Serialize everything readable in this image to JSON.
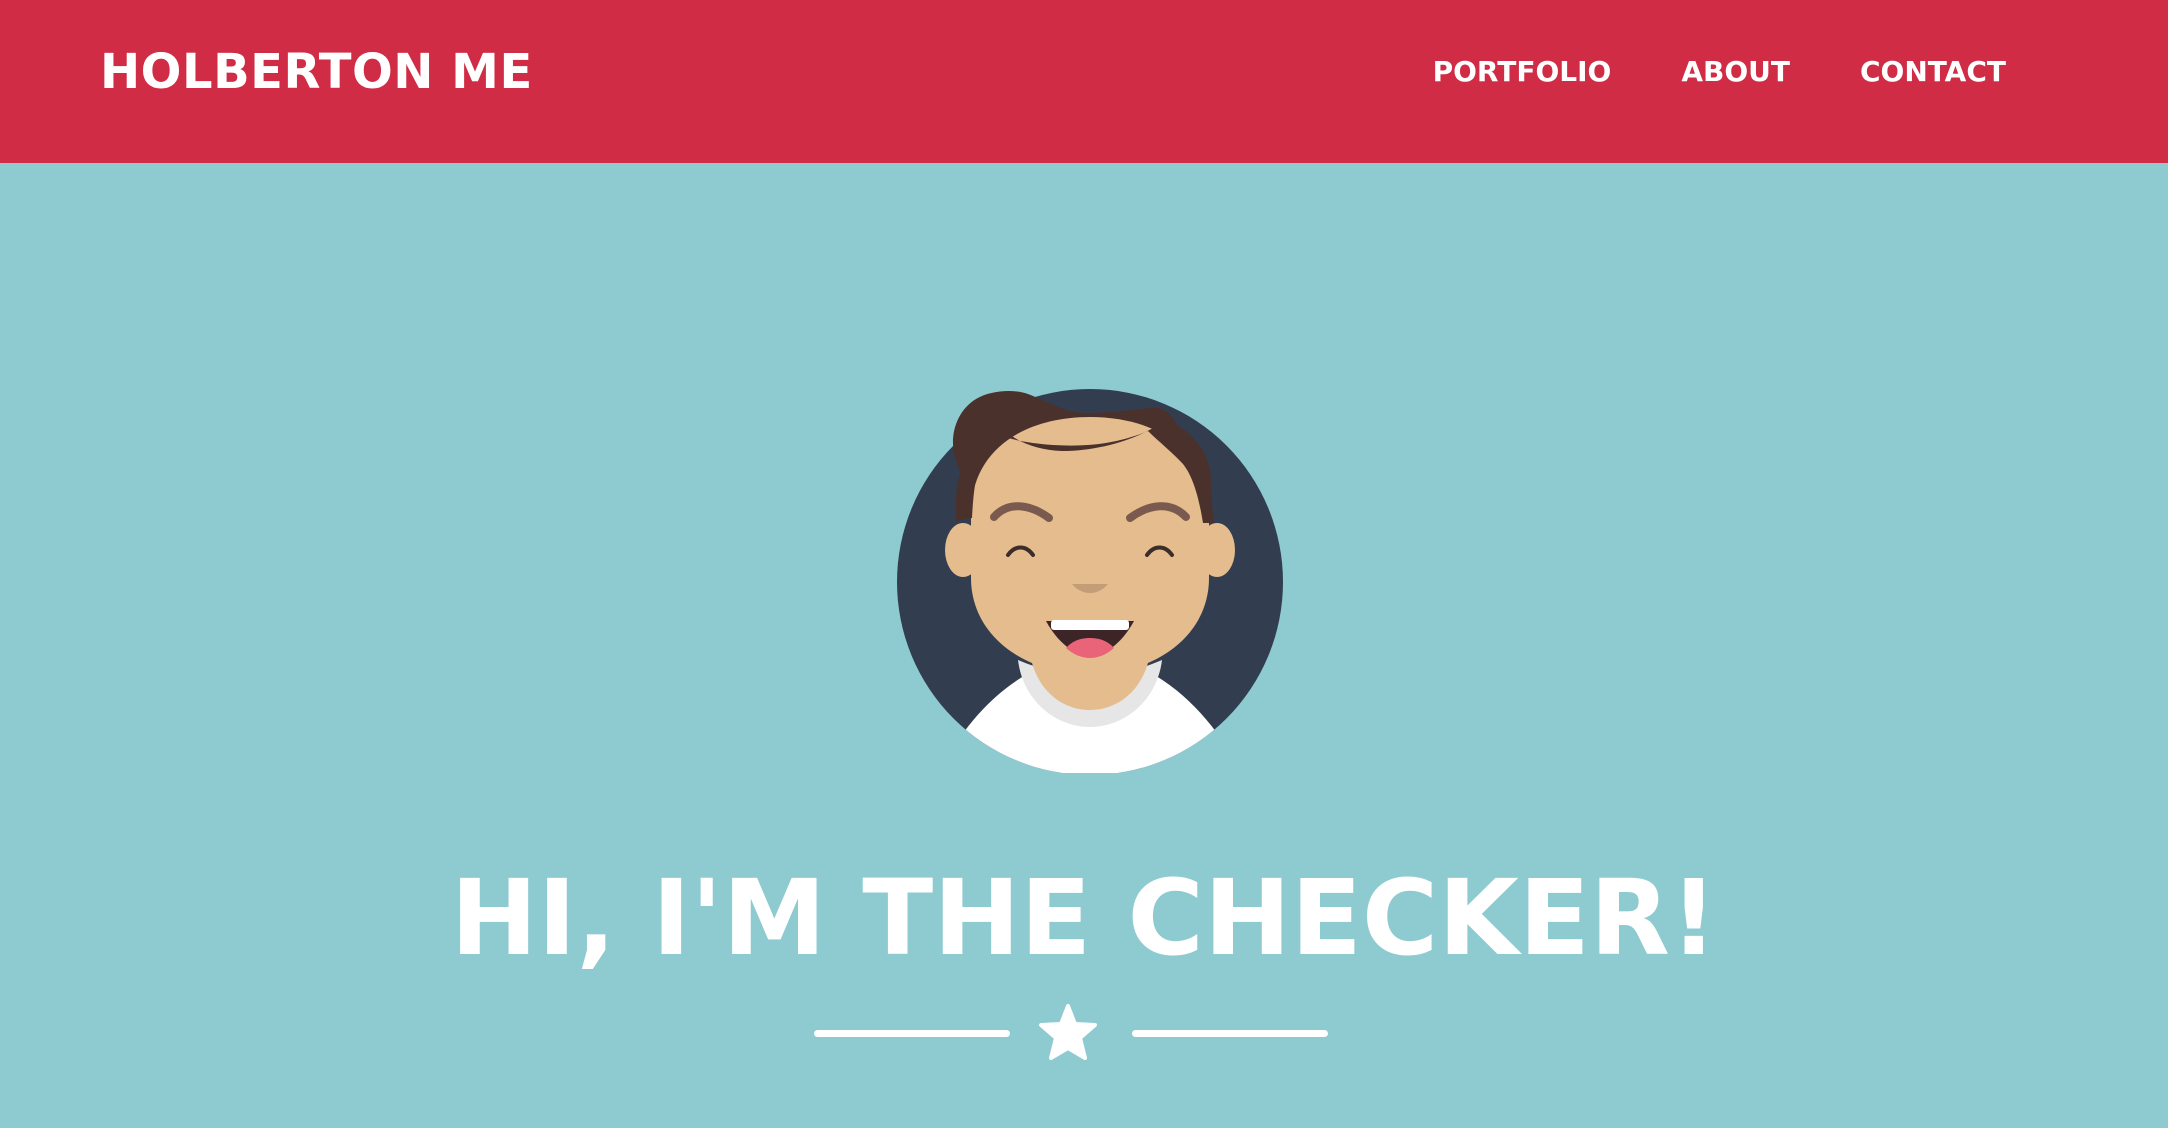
{
  "header": {
    "brand": "HOLBERTON ME",
    "nav": [
      {
        "label": "PORTFOLIO"
      },
      {
        "label": "ABOUT"
      },
      {
        "label": "CONTACT"
      }
    ]
  },
  "hero": {
    "avatar_icon": "avatar-illustration",
    "headline": "HI, I'M THE CHECKER!",
    "divider_icon": "star-icon"
  },
  "colors": {
    "header_bg": "#d02c45",
    "page_bg": "#8ecbd1",
    "avatar_circle": "#323e50",
    "text": "#ffffff"
  }
}
